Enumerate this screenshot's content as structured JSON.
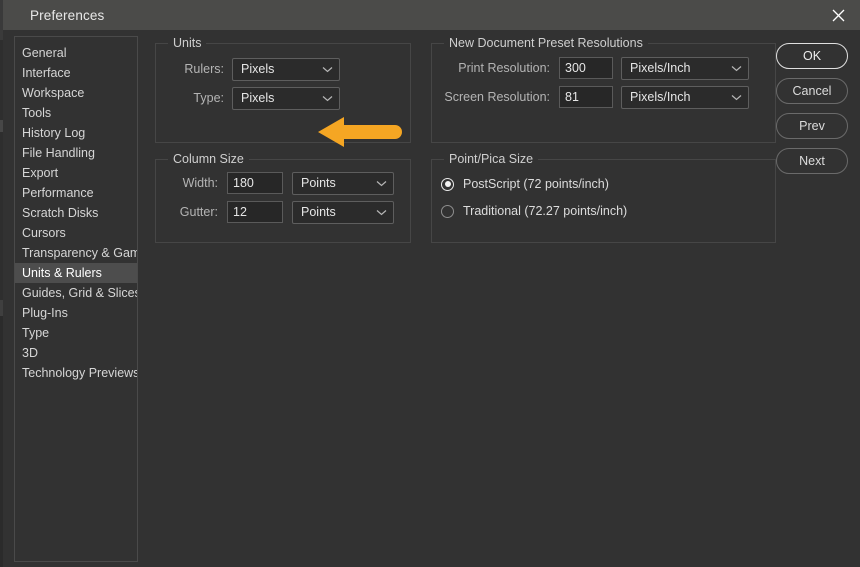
{
  "window": {
    "title": "Preferences",
    "close_icon": "close-icon",
    "titlebar_color": "#4b4b49",
    "background_color": "#323232"
  },
  "sidebar": {
    "selected": "Units & Rulers",
    "items": [
      {
        "label": "General"
      },
      {
        "label": "Interface"
      },
      {
        "label": "Workspace"
      },
      {
        "label": "Tools"
      },
      {
        "label": "History Log"
      },
      {
        "label": "File Handling"
      },
      {
        "label": "Export"
      },
      {
        "label": "Performance"
      },
      {
        "label": "Scratch Disks"
      },
      {
        "label": "Cursors"
      },
      {
        "label": "Transparency & Gamut"
      },
      {
        "label": "Units & Rulers"
      },
      {
        "label": "Guides, Grid & Slices"
      },
      {
        "label": "Plug-Ins"
      },
      {
        "label": "Type"
      },
      {
        "label": "3D"
      },
      {
        "label": "Technology Previews"
      }
    ]
  },
  "panels": {
    "units": {
      "legend": "Units",
      "rulers": {
        "label": "Rulers:",
        "value": "Pixels"
      },
      "type": {
        "label": "Type:",
        "value": "Pixels"
      }
    },
    "column_size": {
      "legend": "Column Size",
      "width": {
        "label": "Width:",
        "value": "180",
        "unit": "Points"
      },
      "gutter": {
        "label": "Gutter:",
        "value": "12",
        "unit": "Points"
      }
    },
    "preset_resolutions": {
      "legend": "New Document Preset Resolutions",
      "print": {
        "label": "Print Resolution:",
        "value": "300",
        "unit": "Pixels/Inch"
      },
      "screen": {
        "label": "Screen Resolution:",
        "value": "81",
        "unit": "Pixels/Inch"
      }
    },
    "point_pica": {
      "legend": "Point/Pica Size",
      "options": [
        {
          "label": "PostScript (72 points/inch)",
          "checked": true
        },
        {
          "label": "Traditional (72.27 points/inch)",
          "checked": false
        }
      ]
    }
  },
  "buttons": {
    "ok": "OK",
    "cancel": "Cancel",
    "prev": "Prev",
    "next": "Next"
  },
  "annotation": {
    "type": "arrow-left",
    "color": "#f5a623",
    "points_at": "Type dropdown in Units panel"
  }
}
